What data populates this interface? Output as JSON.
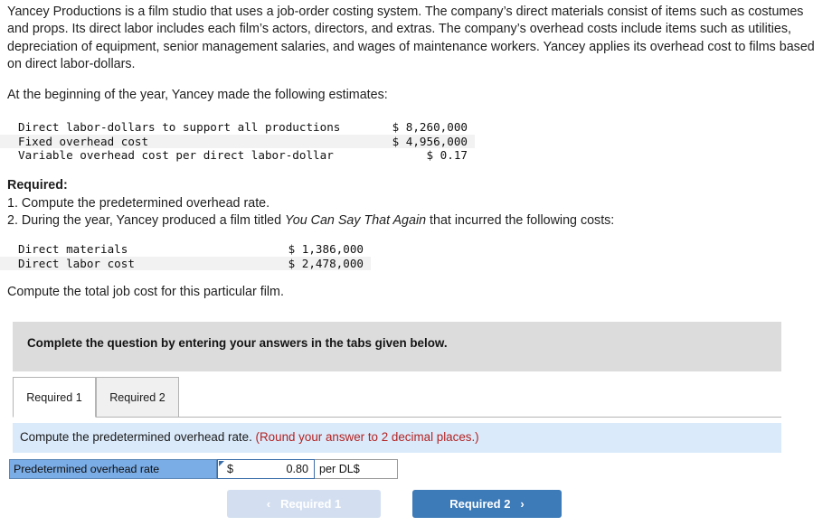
{
  "problem": {
    "intro": "Yancey Productions is a film studio that uses a job-order costing system. The company’s direct materials consist of items such as costumes and props. Its direct labor includes each film’s actors, directors, and extras. The company’s overhead costs include items such as utilities, depreciation of equipment, senior management salaries, and wages of maintenance workers. Yancey applies its overhead cost to films based on direct labor-dollars.",
    "estimates_lead": "At the beginning of the year, Yancey made the following estimates:",
    "estimates_table": {
      "rows": [
        {
          "label": "Direct labor-dollars to support all productions",
          "value": "$ 8,260,000",
          "shaded": false
        },
        {
          "label": "Fixed overhead cost",
          "value": "$ 4,956,000",
          "shaded": true
        },
        {
          "label": "Variable overhead cost per direct labor-dollar",
          "value": "$ 0.17",
          "shaded": false
        }
      ]
    },
    "required_heading": "Required:",
    "required_1": "1. Compute the predetermined overhead rate.",
    "required_2_pre": "2. During the year, Yancey produced a film titled ",
    "required_2_title": "You Can Say That Again",
    "required_2_post": " that incurred the following costs:",
    "costs_table": {
      "rows": [
        {
          "label": "Direct materials",
          "value": "$ 1,386,000",
          "shaded": false
        },
        {
          "label": "Direct labor cost",
          "value": "$ 2,478,000",
          "shaded": true
        }
      ]
    },
    "total_line": "Compute the total job cost for this particular film."
  },
  "banner": {
    "text": "Complete the question by entering your answers in the tabs given below."
  },
  "tabs": {
    "items": [
      {
        "label": "Required 1",
        "active": true
      },
      {
        "label": "Required 2",
        "active": false
      }
    ]
  },
  "info_bar": {
    "instruction": "Compute the predetermined overhead rate.",
    "hint": "(Round your answer to 2 decimal places.)",
    "hint_color": "#b22222"
  },
  "answer": {
    "label": "Predetermined overhead rate",
    "currency": "$",
    "value": "0.80",
    "unit": "per DL$",
    "label_bg": "#7aace5"
  },
  "navigation": {
    "prev_label": "Required 1",
    "prev_chevron": "‹",
    "next_label": "Required 2",
    "next_chevron": "›",
    "prev_bg": "#d3dff0",
    "next_bg": "#3c7ab8"
  }
}
